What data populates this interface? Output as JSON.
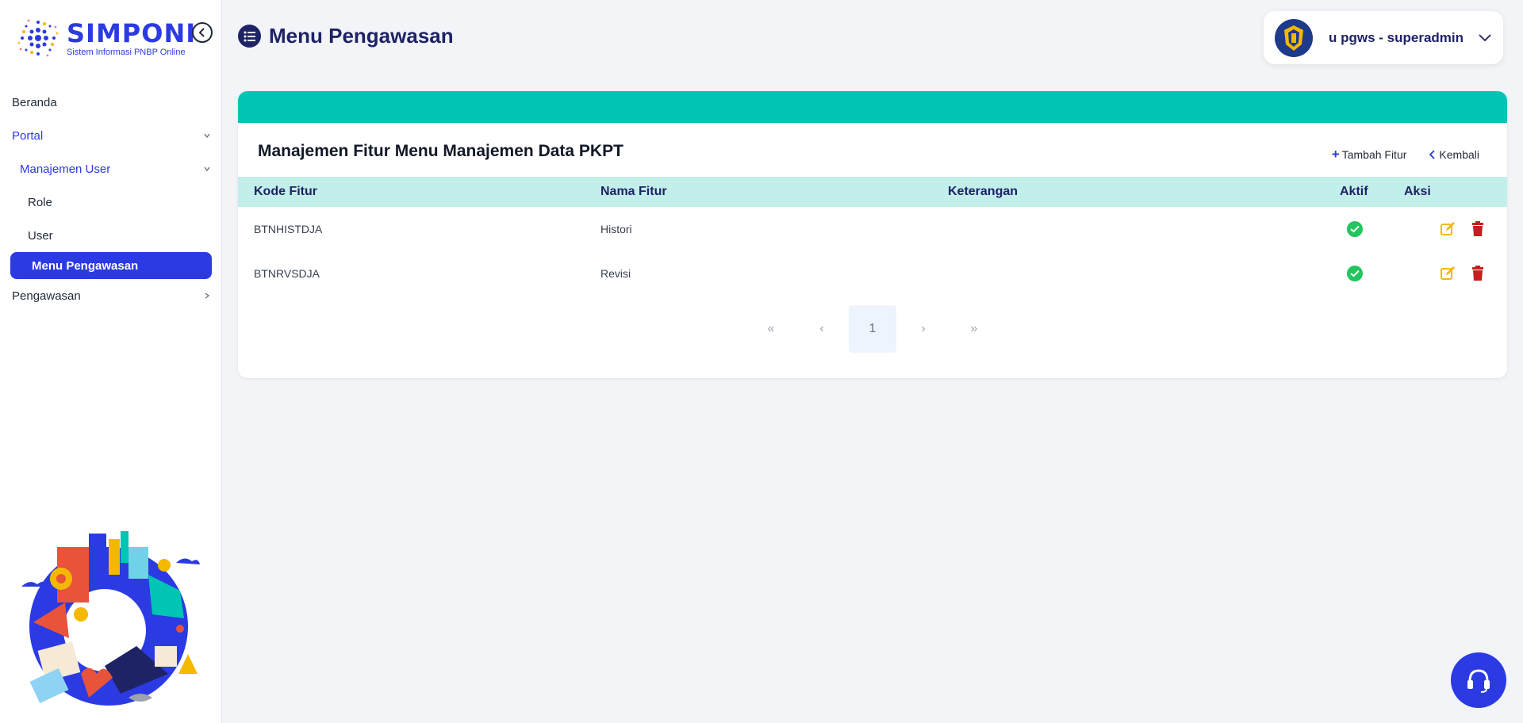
{
  "app": {
    "logo_title": "SIMPONI",
    "logo_subtitle": "Sistem Informasi PNBP Online"
  },
  "sidebar": {
    "items": [
      {
        "label": "Beranda"
      },
      {
        "label": "Portal"
      },
      {
        "label": "Manajemen User"
      },
      {
        "label": "Role"
      },
      {
        "label": "User"
      },
      {
        "label": "Menu Pengawasan"
      },
      {
        "label": "Pengawasan"
      }
    ]
  },
  "header": {
    "title": "Menu Pengawasan",
    "user_name": "u pgws - superadmin"
  },
  "card": {
    "title": "Manajemen Fitur Menu Manajemen Data PKPT",
    "add_label": "Tambah Fitur",
    "back_label": "Kembali"
  },
  "table": {
    "headers": [
      "Kode Fitur",
      "Nama Fitur",
      "Keterangan",
      "Aktif",
      "Aksi"
    ],
    "rows": [
      {
        "kode": "BTNHISTDJA",
        "nama": "Histori",
        "keterangan": "",
        "aktif": true
      },
      {
        "kode": "BTNRVSDJA",
        "nama": "Revisi",
        "keterangan": "",
        "aktif": true
      }
    ]
  },
  "pagination": {
    "first": "«",
    "prev": "‹",
    "current": "1",
    "next": "›",
    "last": "»"
  },
  "colors": {
    "brand_blue": "#2b3ae3",
    "navy": "#1e2366",
    "teal_band": "#00c4b4",
    "table_header_bg": "#c2efea",
    "active_green": "#22c55e",
    "edit_yellow": "#f5b800",
    "delete_red": "#c81e1e"
  },
  "icons": [
    "logo-icon",
    "collapse-left-icon",
    "chevron-down-icon",
    "chevron-right-icon",
    "list-icon",
    "emblem-icon",
    "plus-icon",
    "chevron-left-icon",
    "check-circle-icon",
    "edit-icon",
    "trash-icon",
    "headset-icon"
  ]
}
